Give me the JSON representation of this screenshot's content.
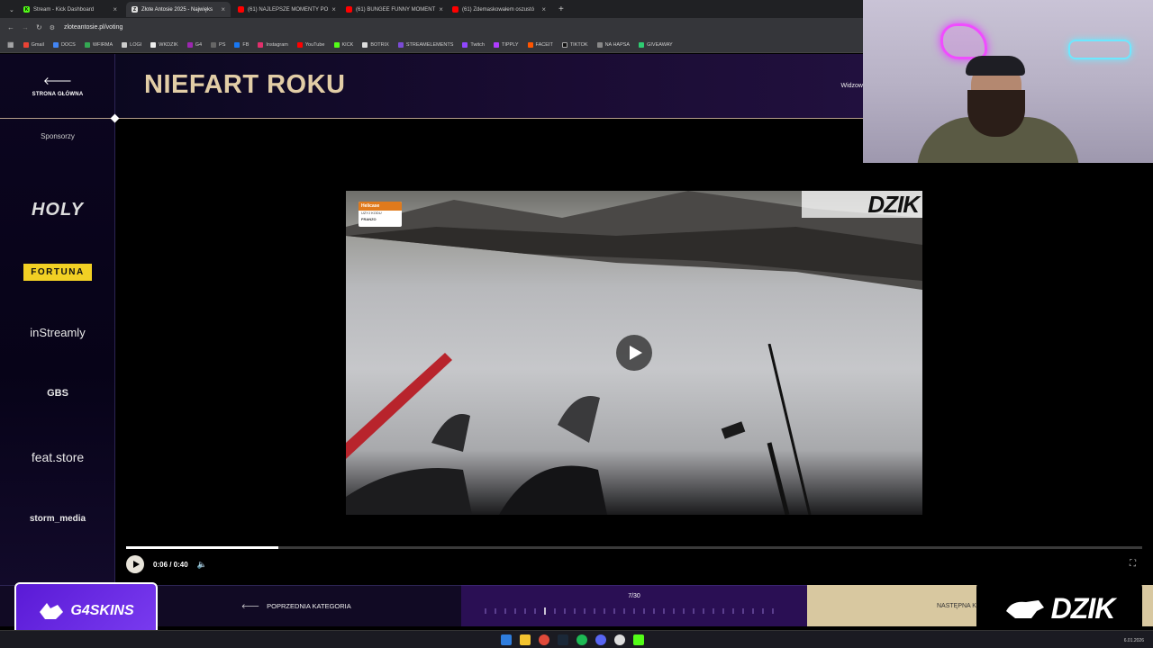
{
  "browser": {
    "tabs": [
      {
        "title": "Stream - Kick Dashboard",
        "active": false
      },
      {
        "title": "Złote Antosie 2025 - Najwięks",
        "active": true
      },
      {
        "title": "(61) NAJLEPSZE MOMENTY PO",
        "active": false
      },
      {
        "title": "(61) BUNGEE FUNNY MOMENT",
        "active": false
      },
      {
        "title": "(61) Zdemaskowałem oszustó",
        "active": false
      }
    ],
    "url": "zloteantosie.pl/voting",
    "bookmarks": [
      "Gmail",
      "DOCS",
      "WFIRMA",
      "LOGI",
      "WKDZIK",
      "G4",
      "PS",
      "FB",
      "Instagram",
      "YouTube",
      "KICK",
      "BOTRIX",
      "STREAMELEMENTS",
      "Twitch",
      "TIPPLY",
      "FACEIT",
      "TIKTOK",
      "NA HAPSA",
      "GIVEAWAY"
    ]
  },
  "sidebar": {
    "home_label": "STRONA GŁÓWNA",
    "sponsors_title": "Sponsorzy",
    "sponsors": [
      "HOLY",
      "FORTUNA",
      "inStreamly",
      "GBS",
      "feat.store",
      "storm_media"
    ]
  },
  "header": {
    "title": "NIEFART ROKU",
    "right_text": "Widzow"
  },
  "video": {
    "overlay_brand": "DZIK",
    "helicase_label": "Helicase",
    "helicase_sub1": "UZYJ KODU",
    "helicase_sub2": "FRANZO",
    "current_time": "0:06",
    "duration": "0:40",
    "time_display": "0:06 / 0:40",
    "progress": 0.15
  },
  "footer": {
    "prev_label": "POPRZEDNIA KATEGORIA",
    "counter": "7/30",
    "next_label": "NASTĘPNA K"
  },
  "overlays": {
    "g4skins": "G4SKINS",
    "dzik": "DZIK"
  },
  "taskbar": {
    "date": "6.01.2026"
  }
}
